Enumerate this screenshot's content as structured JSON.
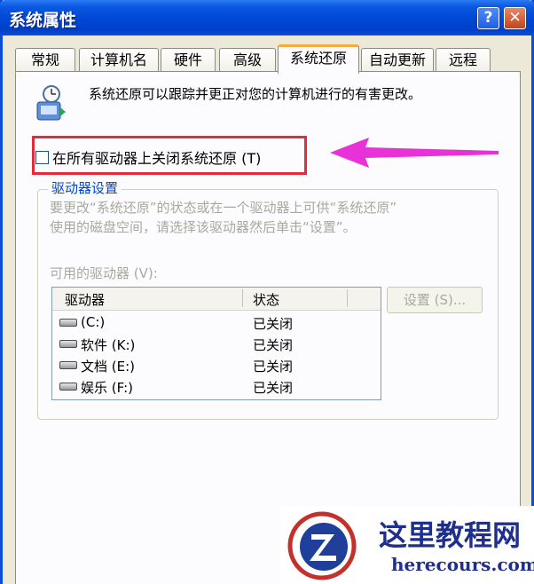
{
  "window": {
    "title": "系统属性",
    "help_label": "?",
    "close_label": "✕"
  },
  "tabs": [
    {
      "label": "常规"
    },
    {
      "label": "计算机名"
    },
    {
      "label": "硬件"
    },
    {
      "label": "高级"
    },
    {
      "label": "系统还原",
      "active": true
    },
    {
      "label": "自动更新"
    },
    {
      "label": "远程"
    }
  ],
  "restore": {
    "icon": "system-restore-icon",
    "intro_text": "系统还原可以跟踪并更正对您的计算机进行的有害更改。",
    "disable_checkbox_label": "在所有驱动器上关闭系统还原 (T)",
    "disable_checked": false
  },
  "drive_settings": {
    "group_title": "驱动器设置",
    "description_line1": "要更改“系统还原”的状态或在一个驱动器上可供“系统还原”",
    "description_line2": "使用的磁盘空间，请选择该驱动器然后单击“设置”。",
    "available_label": "可用的驱动器 (V):",
    "columns": [
      "驱动器",
      "状态"
    ],
    "drives": [
      {
        "name": "(C:)",
        "status": "已关闭"
      },
      {
        "name": "软件 (K:)",
        "status": "已关闭"
      },
      {
        "name": "文档 (E:)",
        "status": "已关闭"
      },
      {
        "name": "娱乐 (F:)",
        "status": "已关闭"
      }
    ],
    "settings_button": "设置 (S)..."
  },
  "watermark": {
    "site_name": "这里教程网",
    "site_url": "herecours.com"
  },
  "colors": {
    "titlebar": "#0046d5",
    "highlight_box": "#e52a3a",
    "arrow": "#e632d6",
    "active_tab_accent": "#f1ab3e"
  }
}
